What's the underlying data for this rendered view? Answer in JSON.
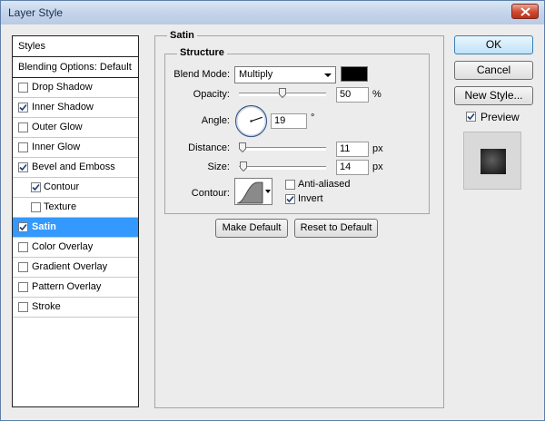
{
  "window": {
    "title": "Layer Style"
  },
  "styles_panel": {
    "header": "Styles",
    "blending_options": "Blending Options: Default",
    "items": [
      {
        "label": "Drop Shadow",
        "checked": false,
        "indent": false,
        "selected": false
      },
      {
        "label": "Inner Shadow",
        "checked": true,
        "indent": false,
        "selected": false
      },
      {
        "label": "Outer Glow",
        "checked": false,
        "indent": false,
        "selected": false
      },
      {
        "label": "Inner Glow",
        "checked": false,
        "indent": false,
        "selected": false
      },
      {
        "label": "Bevel and Emboss",
        "checked": true,
        "indent": false,
        "selected": false
      },
      {
        "label": "Contour",
        "checked": true,
        "indent": true,
        "selected": false
      },
      {
        "label": "Texture",
        "checked": false,
        "indent": true,
        "selected": false
      },
      {
        "label": "Satin",
        "checked": true,
        "indent": false,
        "selected": true
      },
      {
        "label": "Color Overlay",
        "checked": false,
        "indent": false,
        "selected": false
      },
      {
        "label": "Gradient Overlay",
        "checked": false,
        "indent": false,
        "selected": false
      },
      {
        "label": "Pattern Overlay",
        "checked": false,
        "indent": false,
        "selected": false
      },
      {
        "label": "Stroke",
        "checked": false,
        "indent": false,
        "selected": false
      }
    ]
  },
  "satin": {
    "group_title": "Satin",
    "structure_title": "Structure",
    "blend_mode": {
      "label": "Blend Mode:",
      "value": "Multiply",
      "color": "#000000"
    },
    "opacity": {
      "label": "Opacity:",
      "value": "50",
      "unit": "%",
      "level": 0.5
    },
    "angle": {
      "label": "Angle:",
      "value": "19",
      "unit": "°"
    },
    "distance": {
      "label": "Distance:",
      "value": "11",
      "unit": "px",
      "level": 0.045
    },
    "size": {
      "label": "Size:",
      "value": "14",
      "unit": "px",
      "level": 0.057
    },
    "contour": {
      "label": "Contour:",
      "anti_aliased_label": "Anti-aliased",
      "anti_aliased": false,
      "invert_label": "Invert",
      "invert": true
    },
    "make_default": "Make Default",
    "reset_default": "Reset to Default"
  },
  "buttons": {
    "ok": "OK",
    "cancel": "Cancel",
    "new_style": "New Style..."
  },
  "preview": {
    "label": "Preview",
    "checked": true
  },
  "colors": {
    "selection": "#3399ff",
    "accent_button": "#bfe3f8"
  }
}
